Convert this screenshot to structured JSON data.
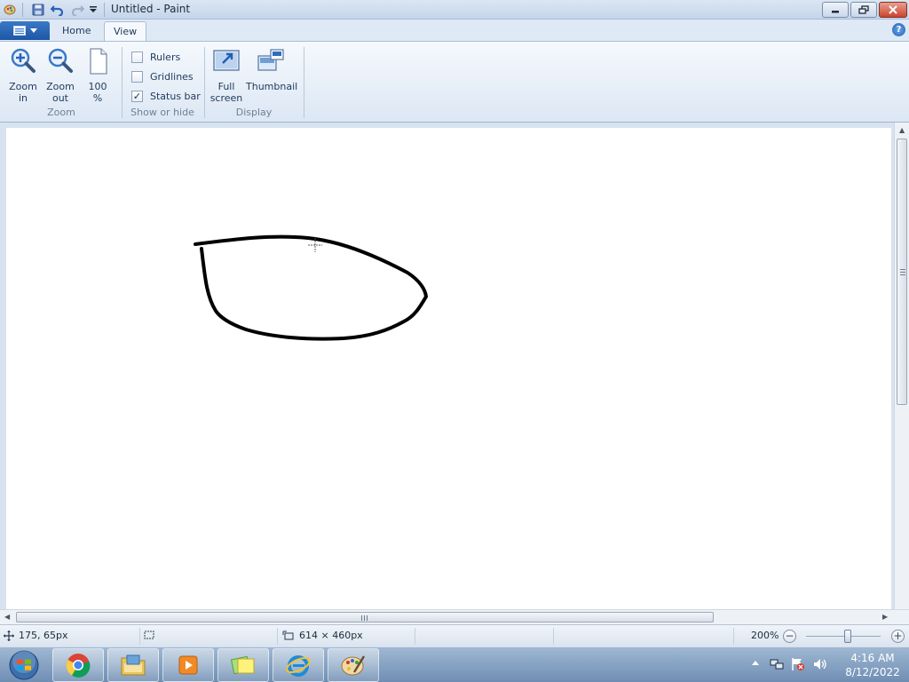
{
  "window": {
    "title": "Untitled - Paint"
  },
  "tabs": [
    {
      "label": "Home",
      "active": false
    },
    {
      "label": "View",
      "active": true
    }
  ],
  "ribbon": {
    "zoom_group": {
      "label": "Zoom",
      "zoom_in": {
        "line1": "Zoom",
        "line2": "in"
      },
      "zoom_out": {
        "line1": "Zoom",
        "line2": "out"
      },
      "hundred": {
        "line1": "100",
        "line2": "%"
      }
    },
    "show_group": {
      "label": "Show or hide",
      "rulers": {
        "label": "Rulers",
        "checked": false
      },
      "gridlines": {
        "label": "Gridlines",
        "checked": false
      },
      "status_bar": {
        "label": "Status bar",
        "checked": true,
        "mark": "✓"
      }
    },
    "display_group": {
      "label": "Display",
      "full_screen": {
        "line1": "Full",
        "line2": "screen"
      },
      "thumbnail": {
        "line1": "Thumbnail"
      }
    }
  },
  "status": {
    "cursor_pos": "175, 65px",
    "image_size": "614 × 460px",
    "zoom": "200%",
    "zoom_level_percent": 200
  },
  "taskbar": {
    "time": "4:16 AM",
    "date": "8/12/2022"
  },
  "colors": {
    "accent": "#1d56a6",
    "ribbon_bg": "#dce7f4",
    "taskbar": "#7a98bb"
  }
}
